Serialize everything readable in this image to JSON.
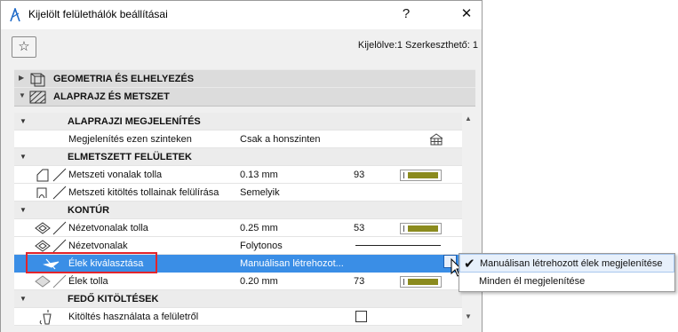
{
  "window": {
    "title": "Kijelölt felülethálók beállításai",
    "help_glyph": "?",
    "close_glyph": "✕"
  },
  "toolbar": {
    "favorites_glyph": "☆",
    "selection_info": "Kijelölve:1 Szerkeszthető: 1"
  },
  "sections": [
    {
      "label": "GEOMETRIA ÉS ELHELYEZÉS",
      "expanded": false
    },
    {
      "label": "ALAPRAJZ ÉS METSZET",
      "expanded": true
    }
  ],
  "tree": {
    "groups": {
      "floorplan_display": "ALAPRAJZI MEGJELENÍTÉS",
      "cut_surfaces": "ELMETSZETT FELÜLETEK",
      "outlines": "KONTÚR",
      "cover_fills": "FEDŐ KITÖLTÉSEK"
    },
    "rows": {
      "show_on_stories": {
        "label": "Megjelenítés ezen szinteken",
        "value": "Csak a honszinten"
      },
      "cut_line_pen": {
        "label": "Metszeti vonalak tolla",
        "value": "0.13 mm",
        "pen": "93"
      },
      "cut_fill_pen_override": {
        "label": "Metszeti kitöltés tollainak felülírása",
        "value": "Semelyik"
      },
      "view_line_pen": {
        "label": "Nézetvonalak tolla",
        "value": "0.25 mm",
        "pen": "53"
      },
      "view_lines": {
        "label": "Nézetvonalak",
        "value": "Folytonos"
      },
      "edge_selection": {
        "label": "Élek kiválasztása",
        "value": "Manuálisan létrehozot..."
      },
      "edge_pen": {
        "label": "Élek tolla",
        "value": "0.20 mm",
        "pen": "73"
      },
      "use_fill_from_surface": {
        "label": "Kitöltés használata a felületről",
        "checked": false
      }
    }
  },
  "dropdown": {
    "options": [
      {
        "label": "Manuálisan létrehozott élek megjelenítése",
        "selected": true
      },
      {
        "label": "Minden él megjelenítése",
        "selected": false
      }
    ]
  },
  "colors": {
    "selection": "#3a8ee6",
    "pen_swatch": "#8b8b1e",
    "highlight": "#e3242b"
  }
}
